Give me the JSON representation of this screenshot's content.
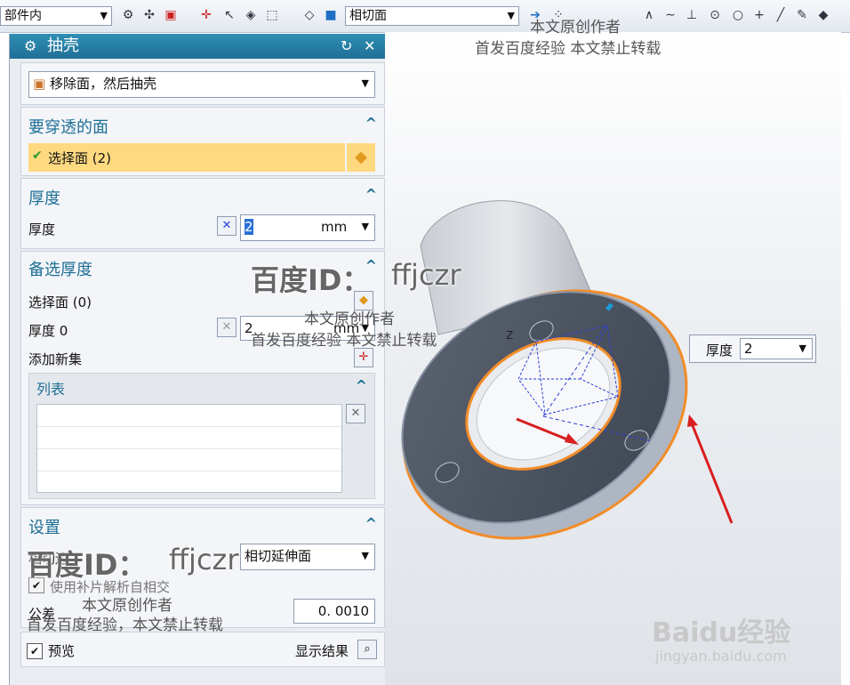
{
  "toolbar": {
    "scope_value": "部件内",
    "snap_value": "相切面"
  },
  "watermark": {
    "author": "本文原创作者",
    "notice": "首发百度经验  本文禁止转载",
    "notice2": "首发百度经验 本文禁止转载",
    "notice3": "首发百度经验，本文禁止转载",
    "id_label": "百度ID：",
    "id_value": "ffjczr"
  },
  "panel": {
    "title": "抽壳",
    "type_value": "移除面，然后抽壳",
    "faces": {
      "header": "要穿透的面",
      "select_label": "选择面 (2)"
    },
    "thickness": {
      "header": "厚度",
      "label": "厚度",
      "value": "2",
      "unit": "mm"
    },
    "alt_thickness": {
      "header": "备选厚度",
      "select_label": "选择面 (0)",
      "thickness_label": "厚度 0",
      "value": "2",
      "unit": "mm",
      "add_set": "添加新集",
      "list_header": "列表"
    },
    "settings": {
      "header": "设置",
      "tangent_label": "相切边",
      "tangent_value": "相切延伸面",
      "patch_label": "使用补片解析自相交",
      "tolerance_label": "公差",
      "tolerance_value": "0. 0010"
    },
    "preview_label": "预览",
    "show_result_label": "显示结果"
  },
  "viewport": {
    "thickness_label": "厚度",
    "thickness_value": "2",
    "axis_z": "Z"
  },
  "brand": {
    "logo": "Baidu经验",
    "url": "jingyan.baidu.com"
  }
}
